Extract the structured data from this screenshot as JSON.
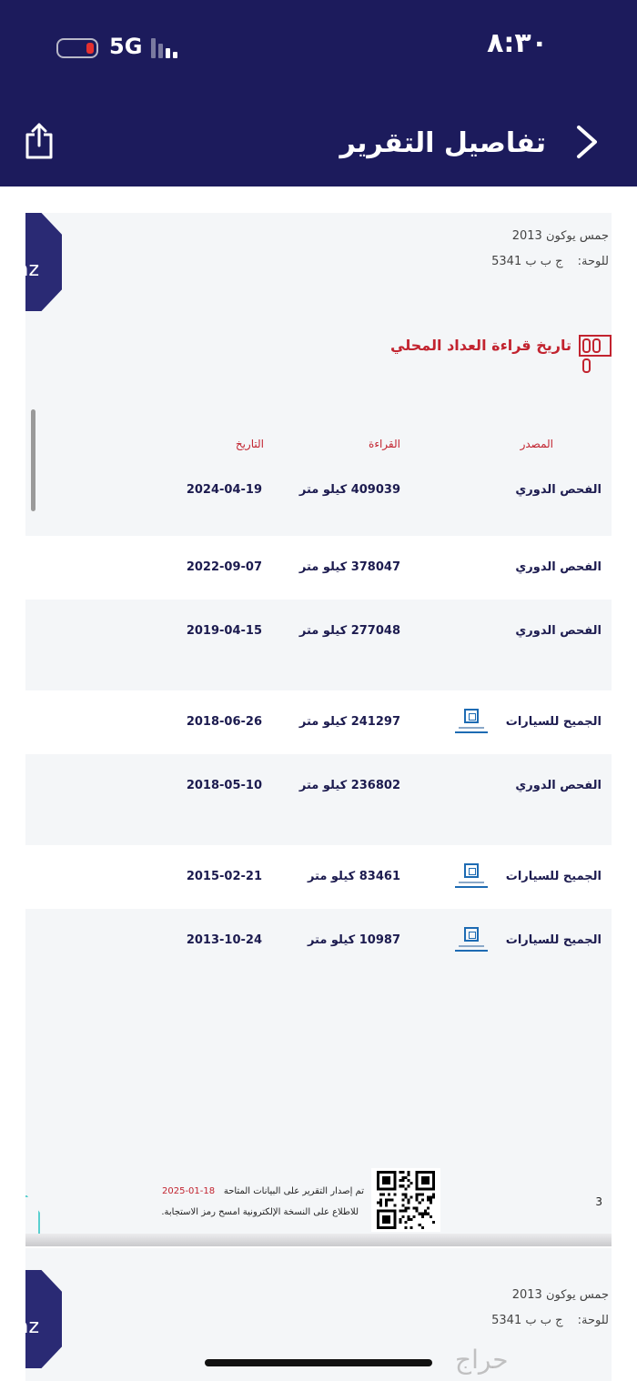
{
  "status_bar": {
    "time": "٨:٣٠",
    "network": "5G"
  },
  "header": {
    "title": "تفاصيل التقرير"
  },
  "report": {
    "logo_text": "az",
    "logo_text_top": "o",
    "car_model": "جمس يوكون 2013",
    "plate_label": "للوحة:",
    "plate_value": "ج ب ب 5341",
    "section_title": "تاريخ قراءة العداد المحلي",
    "columns": {
      "source": "المصدر",
      "reading": "القراءة",
      "date": "التاريخ"
    },
    "rows": [
      {
        "source": "الفحص الدوري",
        "reading": "409039 كيلو متر",
        "date": "2024-04-19",
        "has_logo": false
      },
      {
        "source": "الفحص الدوري",
        "reading": "378047 كيلو متر",
        "date": "2022-09-07",
        "has_logo": false
      },
      {
        "source": "الفحص الدوري",
        "reading": "277048 كيلو متر",
        "date": "2019-04-15",
        "has_logo": false
      },
      {
        "source": "الجميح للسيارات",
        "reading": "241297 كيلو متر",
        "date": "2018-06-26",
        "has_logo": true
      },
      {
        "source": "الفحص الدوري",
        "reading": "236802 كيلو متر",
        "date": "2018-05-10",
        "has_logo": false
      },
      {
        "source": "الجميح للسيارات",
        "reading": "83461 كيلو متر",
        "date": "2015-02-21",
        "has_logo": true
      },
      {
        "source": "الجميح للسيارات",
        "reading": "10987 كيلو متر",
        "date": "2013-10-24",
        "has_logo": true
      }
    ],
    "footer_note_1": "تم إصدار التقرير على البيانات المتاحة",
    "footer_date": "2025-01-18",
    "footer_note_2": "للاطلاع على النسخة الإلكترونية امسح رمز الاستجابة.",
    "page_number": "3"
  },
  "report_page_2": {
    "logo_text": "az",
    "logo_text_top": "o",
    "car_model": "جمس يوكون 2013",
    "plate_label": "للوحة:",
    "plate_value": "ج ب ب 5341"
  },
  "watermark": "حراج",
  "colors": {
    "header_bg": "#1c1b5c",
    "accent_red": "#c2232f",
    "text_navy": "#1c1b4f"
  }
}
